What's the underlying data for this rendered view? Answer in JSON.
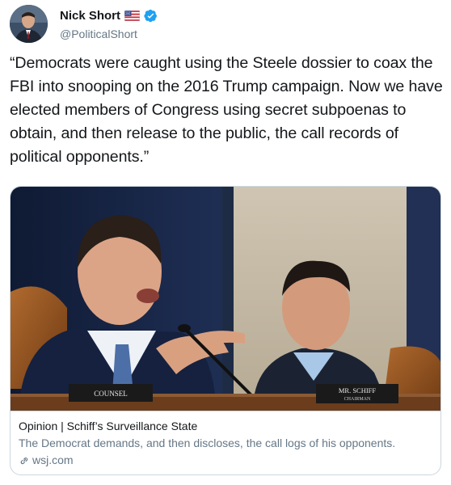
{
  "author": {
    "display_name": "Nick Short",
    "handle": "@PoliticalShort",
    "flag_icon": "us-flag-icon",
    "verified_icon": "verified-badge-icon",
    "verified_color": "#1da1f2"
  },
  "tweet": {
    "text": "“Democrats were caught using the Steele dossier to coax the FBI into snooping on the 2016 Trump campaign. Now we have elected members of Congress using secret subpoenas to obtain, and then release to the public, the call records of political opponents.”"
  },
  "card": {
    "image_placards": {
      "left": "COUNSEL",
      "right_line1": "MR. SCHIFF",
      "right_line2": "CHAIRMAN"
    },
    "title": "Opinion | Schiff’s Surveillance State",
    "description": "The Democrat demands, and then discloses, the call logs of his opponents.",
    "domain": "wsj.com",
    "link_icon": "link-icon"
  }
}
